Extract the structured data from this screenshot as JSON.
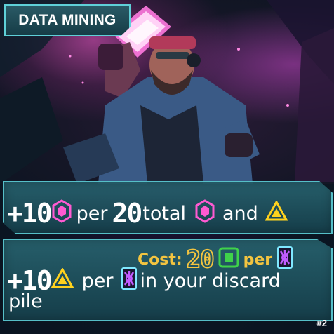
{
  "card": {
    "title": "DATA MINING",
    "number": "#2",
    "cost": {
      "label": "Cost:",
      "value": "20",
      "resource_icon": "green-chip-icon",
      "per_label": "per",
      "per_icon": "purple-virus-card-icon"
    },
    "effects": [
      {
        "amount": "+10",
        "amount_icon": "pink-hexagon-gem-icon",
        "per_label": "per",
        "threshold": "20",
        "threshold_label": "total",
        "and_label": "and",
        "icons": [
          "pink-hexagon-gem-icon",
          "yellow-triangle-icon"
        ]
      },
      {
        "amount": "+10",
        "amount_icon": "yellow-triangle-icon",
        "per_label": "per",
        "target_icon": "purple-virus-card-icon",
        "tail_text": "in your discard",
        "tail_text_2": "pile"
      }
    ]
  },
  "colors": {
    "panel": "#1d5562",
    "panel_border": "#56bfc8",
    "cost": "#f3c440",
    "gem": "#ff5ad2",
    "triangle": "#ffd21e",
    "chip": "#3fd24a",
    "virus": "#c25cff"
  }
}
